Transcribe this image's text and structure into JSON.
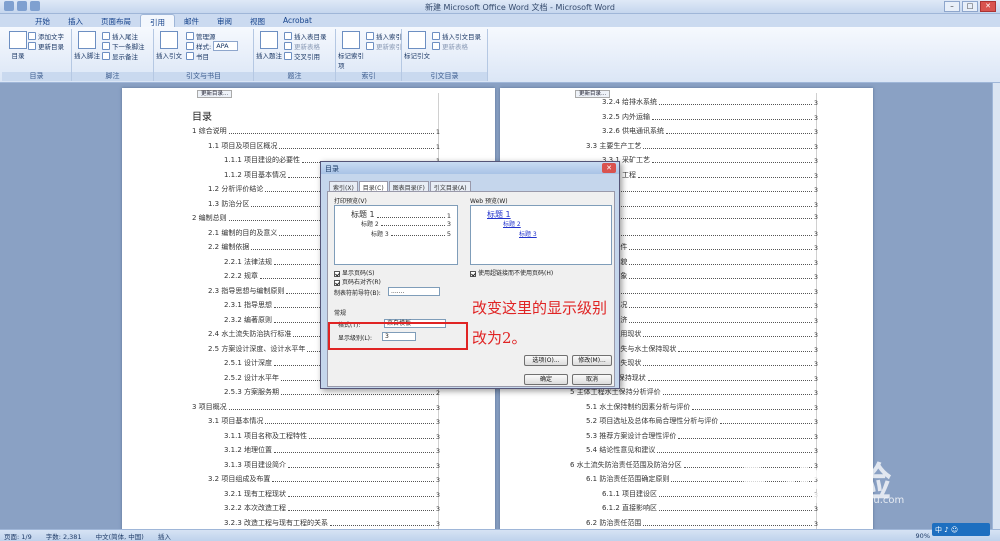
{
  "window": {
    "title": "新建 Microsoft Office Word 文档 - Microsoft Word"
  },
  "tabs": [
    {
      "label": "开始"
    },
    {
      "label": "插入"
    },
    {
      "label": "页面布局"
    },
    {
      "label": "引用",
      "active": true
    },
    {
      "label": "邮件"
    },
    {
      "label": "审阅"
    },
    {
      "label": "视图"
    },
    {
      "label": "Acrobat"
    }
  ],
  "ribbon": {
    "g1": {
      "label": "目录",
      "big": "目录",
      "add": "添加文字",
      "update": "更新目录"
    },
    "g2": {
      "label": "脚注",
      "big": "插入脚注",
      "endnote": "插入尾注",
      "next": "下一条脚注",
      "show": "显示备注"
    },
    "g3": {
      "label": "引文与书目",
      "big": "插入引文",
      "manage": "管理源",
      "style": "样式:",
      "style_val": "APA",
      "biblio": "书目"
    },
    "g4": {
      "label": "题注",
      "big": "插入题注",
      "figtoc": "插入表目录",
      "upd": "更新表格",
      "cross": "交叉引用"
    },
    "g5": {
      "label": "索引",
      "big": "标记索引项",
      "ins": "插入索引",
      "upd": "更新索引"
    },
    "g6": {
      "label": "引文目录",
      "big": "标记引文",
      "ins": "插入引文目录",
      "upd": "更新表格"
    }
  },
  "page1": {
    "tab_label": "更新目录...",
    "heading": "目录",
    "entries": [
      {
        "text": "1 综合说明",
        "page": "1",
        "level": 1
      },
      {
        "text": "1.1 项目及项目区概况",
        "page": "1",
        "level": 2
      },
      {
        "text": "1.1.1 项目建设的必要性",
        "page": "1",
        "level": 3
      },
      {
        "text": "1.1.2 项目基本情况",
        "page": "1",
        "level": 3
      },
      {
        "text": "1.2 分析评价结论",
        "page": "1",
        "level": 2
      },
      {
        "text": "1.3 防治分区",
        "page": "1",
        "level": 2
      },
      {
        "text": "2 编制总则",
        "page": "1",
        "level": 1
      },
      {
        "text": "2.1 编制的目的及意义",
        "page": "1",
        "level": 2
      },
      {
        "text": "2.2 编制依据",
        "page": "1",
        "level": 2
      },
      {
        "text": "2.2.1 法律法规",
        "page": "1",
        "level": 3
      },
      {
        "text": "2.2.2 规章",
        "page": "1",
        "level": 3
      },
      {
        "text": "2.3 指导思想与编制原则",
        "page": "2",
        "level": 2
      },
      {
        "text": "2.3.1 指导思想",
        "page": "2",
        "level": 3
      },
      {
        "text": "2.3.2 编著原则",
        "page": "2",
        "level": 3
      },
      {
        "text": "2.4 水土流失防治执行标准",
        "page": "2",
        "level": 2
      },
      {
        "text": "2.5 方案设计深度、设计水平年",
        "page": "2",
        "level": 2
      },
      {
        "text": "2.5.1 设计深度",
        "page": "2",
        "level": 3
      },
      {
        "text": "2.5.2 设计水平年",
        "page": "2",
        "level": 3
      },
      {
        "text": "2.5.3 方案服务期",
        "page": "2",
        "level": 3
      },
      {
        "text": "3 项目概况",
        "page": "3",
        "level": 1
      },
      {
        "text": "3.1 项目基本情况",
        "page": "3",
        "level": 2
      },
      {
        "text": "3.1.1 项目名称及工程特性",
        "page": "3",
        "level": 3
      },
      {
        "text": "3.1.2 地理位置",
        "page": "3",
        "level": 3
      },
      {
        "text": "3.1.3 项目建设简介",
        "page": "3",
        "level": 3
      },
      {
        "text": "3.2 项目组成及布置",
        "page": "3",
        "level": 2
      },
      {
        "text": "3.2.1 现有工程现状",
        "page": "3",
        "level": 3
      },
      {
        "text": "3.2.2 本次改造工程",
        "page": "3",
        "level": 3
      },
      {
        "text": "3.2.3 改造工程与现有工程的关系",
        "page": "3",
        "level": 3
      }
    ]
  },
  "page2": {
    "tab_label": "更新目录...",
    "entries": [
      {
        "text": "3.2.4 给排水系统",
        "page": "3",
        "level": 3
      },
      {
        "text": "3.2.5 内外运输",
        "page": "3",
        "level": 3
      },
      {
        "text": "3.2.6 供电通讯系统",
        "page": "3",
        "level": 3
      },
      {
        "text": "3.3 主要生产工艺",
        "page": "3",
        "level": 2
      },
      {
        "text": "3.3.1 采矿工艺",
        "page": "3",
        "level": 3
      },
      {
        "text": "3.3.2 工程",
        "page": "3",
        "level": 3
      },
      {
        "text": "3.4 施",
        "page": "3",
        "level": 2
      },
      {
        "text": "3.5 平衡",
        "page": "3",
        "level": 2
      },
      {
        "text": "",
        "page": "3",
        "level": 2
      },
      {
        "text": "4 项",
        "page": "3",
        "level": 1
      },
      {
        "text": "4.1 地质条件",
        "page": "3",
        "level": 2
      },
      {
        "text": "4.2 地形地貌",
        "page": "3",
        "level": 2
      },
      {
        "text": "4.3 气候气象",
        "page": "3",
        "level": 2
      },
      {
        "text": "4.4 水文",
        "page": "3",
        "level": 2
      },
      {
        "text": "4.5 经济概况",
        "page": "3",
        "level": 2
      },
      {
        "text": "4.6 社会经济",
        "page": "3",
        "level": 2
      },
      {
        "text": "4.7 土地利用现状",
        "page": "3",
        "level": 2
      },
      {
        "text": "4.8 水土流失与水土保持现状",
        "page": "3",
        "level": 2
      },
      {
        "text": "4.9 水土流失现状",
        "page": "3",
        "level": 2
      },
      {
        "text": "4.10 水土保持现状",
        "page": "3",
        "level": 2
      },
      {
        "text": "5 主体工程水土保持分析评价",
        "page": "3",
        "level": 1
      },
      {
        "text": "5.1 水土保持制约因素分析与评价",
        "page": "3",
        "level": 2
      },
      {
        "text": "5.2 项目选址及总体布局合理性分析与评价",
        "page": "3",
        "level": 2
      },
      {
        "text": "5.3 推荐方案设计合理性评价",
        "page": "3",
        "level": 2
      },
      {
        "text": "5.4 结论性意见和建议",
        "page": "3",
        "level": 2
      },
      {
        "text": "6 水土流失防治责任范围及防治分区",
        "page": "3",
        "level": 1
      },
      {
        "text": "6.1 防治责任范围确定原则",
        "page": "3",
        "level": 2
      },
      {
        "text": "6.1.1 项目建设区",
        "page": "3",
        "level": 3
      },
      {
        "text": "6.1.2 直接影响区",
        "page": "3",
        "level": 3
      },
      {
        "text": "6.2 防治责任范围",
        "page": "3",
        "level": 2
      }
    ]
  },
  "dialog": {
    "title": "目录",
    "close": "✕",
    "tabs": [
      "索引(X)",
      "目录(C)",
      "图表目录(F)",
      "引文目录(A)"
    ],
    "print_preview_label": "打印预览(V)",
    "web_preview_label": "Web 预览(W)",
    "print_preview": [
      {
        "text": "标题 1",
        "page": "1"
      },
      {
        "text": "标题 2",
        "page": "3"
      },
      {
        "text": "标题 3",
        "page": "5"
      }
    ],
    "web_preview": [
      "标题 1",
      "标题 2",
      "标题 3"
    ],
    "show_page_numbers": "显示页码(S)",
    "right_align": "页码右对齐(R)",
    "tab_leader_label": "制表符前导符(B):",
    "tab_leader_value": ".......",
    "use_hyperlinks": "使用超链接而不使用页码(H)",
    "general_label": "常规",
    "format_label": "格式(T):",
    "format_value": "来自模板",
    "show_levels_label": "显示级别(L):",
    "show_levels_value": "3",
    "options_button": "选项(O)...",
    "modify_button": "修改(M)...",
    "ok_button": "确定",
    "cancel_button": "取消"
  },
  "annotation": {
    "line1": "改变这里的显示级别",
    "line2": "改为2。"
  },
  "status": {
    "page": "页面: 1/9",
    "words": "字数: 2,381",
    "lang": "中文(简体, 中国)",
    "mode": "插入",
    "zoom": "90%"
  },
  "watermark": {
    "brand": "Bai经验",
    "url": "jingyan.baidu.com"
  },
  "ime": {
    "label": "中 ♪ ☺"
  },
  "colors": {
    "accent": "#15428b",
    "annotation": "#e02424"
  }
}
